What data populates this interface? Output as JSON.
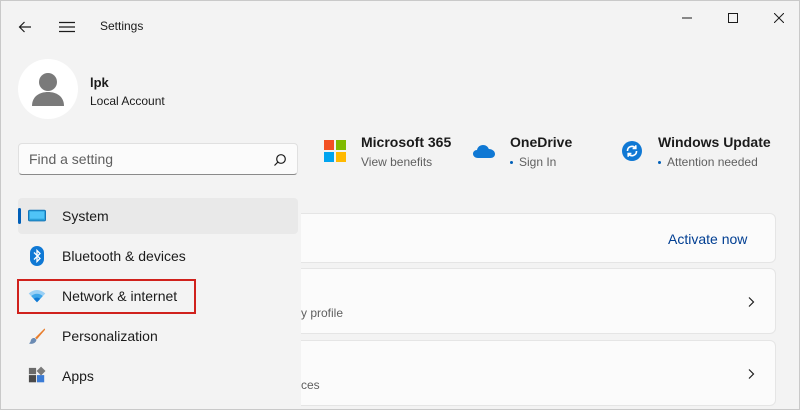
{
  "window": {
    "title": "Settings"
  },
  "profile": {
    "name": "lpk",
    "account_type": "Local Account"
  },
  "search": {
    "placeholder": "Find a setting",
    "value": ""
  },
  "nav": {
    "items": [
      {
        "id": "system",
        "label": "System",
        "icon": "system-icon",
        "selected": true
      },
      {
        "id": "bluetooth",
        "label": "Bluetooth & devices",
        "icon": "bluetooth-icon"
      },
      {
        "id": "network",
        "label": "Network & internet",
        "icon": "wifi-icon",
        "highlighted": true
      },
      {
        "id": "personalization",
        "label": "Personalization",
        "icon": "brush-icon"
      },
      {
        "id": "apps",
        "label": "Apps",
        "icon": "apps-icon"
      }
    ]
  },
  "tiles": [
    {
      "title": "Microsoft 365",
      "subtitle": "View benefits",
      "icon": "microsoft-logo-icon"
    },
    {
      "title": "OneDrive",
      "subtitle": "Sign In",
      "icon": "cloud-icon"
    },
    {
      "title": "Windows Update",
      "subtitle": "Attention needed",
      "icon": "sync-icon"
    }
  ],
  "cards": {
    "activation": {
      "link": "Activate now"
    },
    "card2": {
      "sub": "y profile"
    },
    "card3": {
      "sub": "ces"
    }
  },
  "colors": {
    "accent": "#005fb8",
    "highlight": "#d0211c",
    "link": "#003e92"
  }
}
